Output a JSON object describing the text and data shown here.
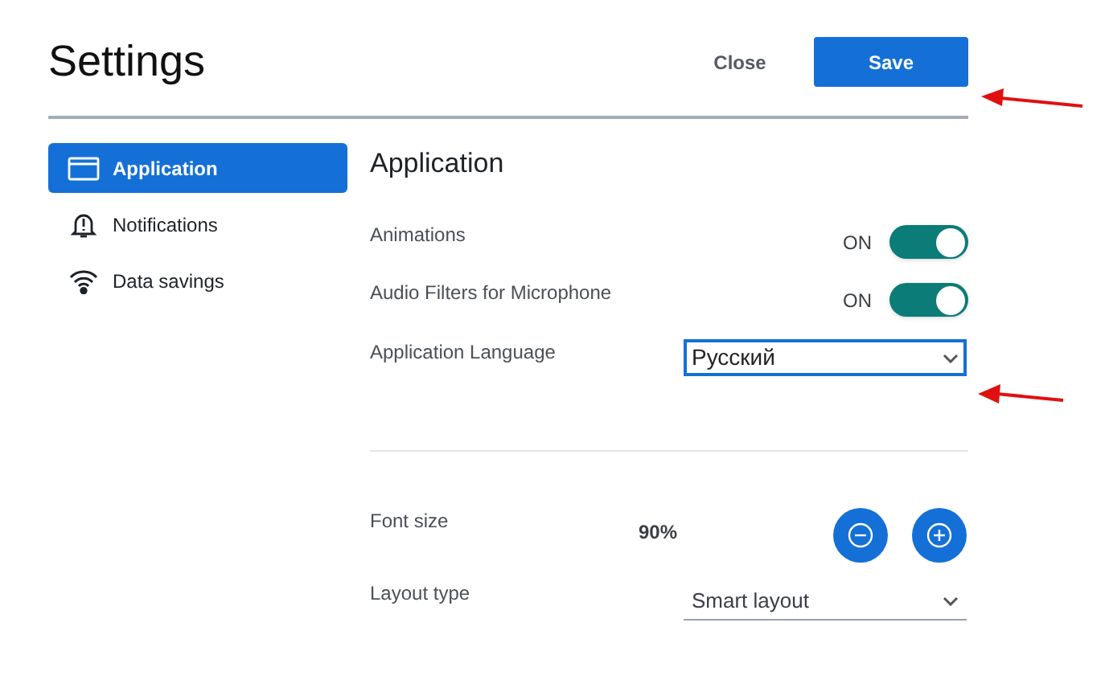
{
  "header": {
    "title": "Settings",
    "close_button": "Close",
    "save_button": "Save"
  },
  "sidebar": {
    "items": [
      {
        "label": "Application",
        "selected": true
      },
      {
        "label": "Notifications",
        "selected": false
      },
      {
        "label": "Data savings",
        "selected": false
      }
    ]
  },
  "section": {
    "title": "Application",
    "settings": [
      {
        "kind": "toggle",
        "label": "Animations",
        "state_text": "ON",
        "on": true
      },
      {
        "kind": "toggle",
        "label": "Audio Filters for Microphone",
        "state_text": "ON",
        "on": true
      },
      {
        "kind": "select",
        "label": "Application Language",
        "value": "Русский",
        "focused": true
      }
    ]
  },
  "display": {
    "settings": [
      {
        "kind": "stepper",
        "label": "Font size",
        "value": "90%"
      },
      {
        "kind": "select",
        "label": "Layout type",
        "value": "Smart layout",
        "focused": false
      }
    ]
  }
}
